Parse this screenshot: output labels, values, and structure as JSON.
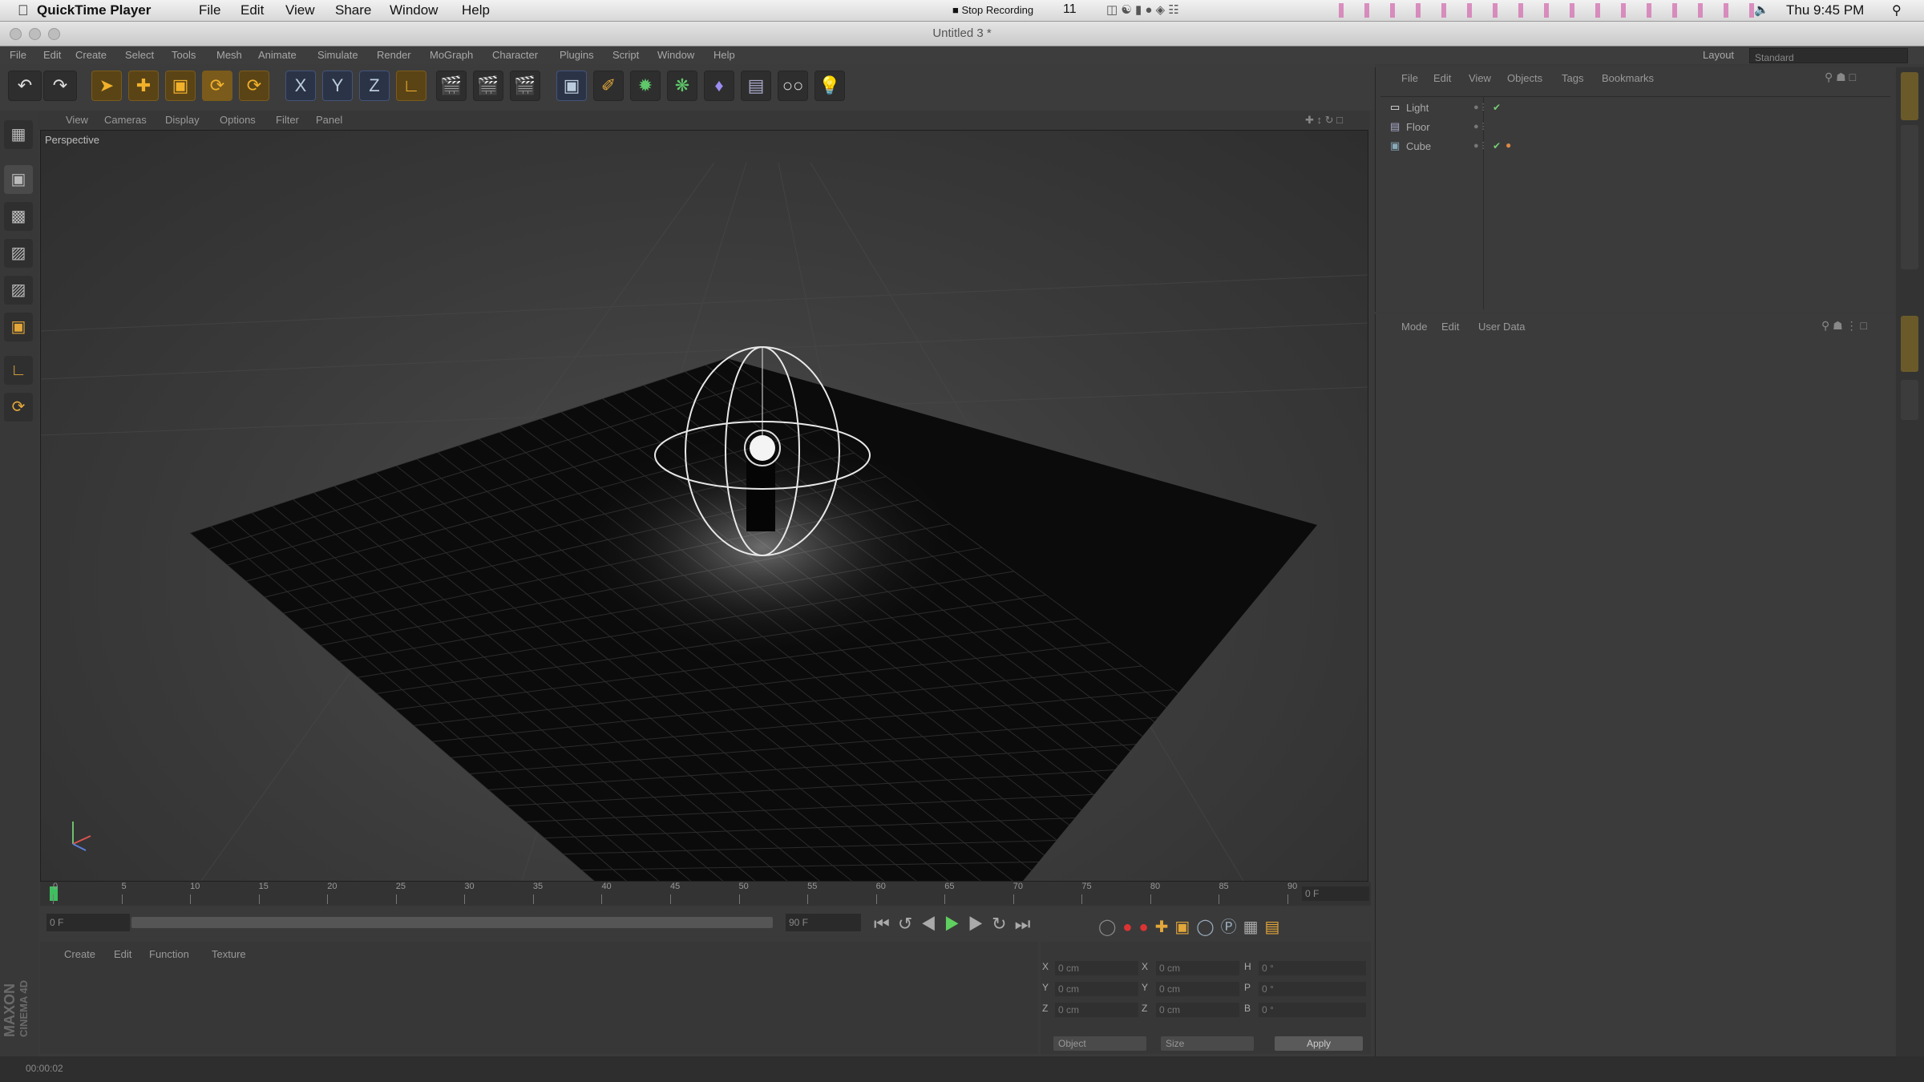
{
  "menubar": {
    "app_name": "QuickTime Player",
    "items": [
      "File",
      "Edit",
      "View",
      "Share",
      "Window",
      "Help"
    ],
    "recording": "Stop Recording",
    "status_count": "11",
    "clock": "Thu 9:45 PM"
  },
  "window": {
    "title": "Untitled 3 *"
  },
  "c4d_menu": [
    "File",
    "Edit",
    "Create",
    "Select",
    "Tools",
    "Mesh",
    "Animate",
    "Simulate",
    "Render",
    "MoGraph",
    "Character",
    "Plugins",
    "Script",
    "Window",
    "Help"
  ],
  "layout": {
    "label": "Layout",
    "value": "Standard"
  },
  "toolbar": {
    "x": "X",
    "y": "Y",
    "z": "Z"
  },
  "viewport": {
    "menu": [
      "View",
      "Cameras",
      "Display",
      "Options",
      "Filter",
      "Panel"
    ],
    "label": "Perspective"
  },
  "object_manager": {
    "menu": [
      "File",
      "Edit",
      "View",
      "Objects",
      "Tags",
      "Bookmarks"
    ],
    "objects": [
      {
        "name": "Light"
      },
      {
        "name": "Floor"
      },
      {
        "name": "Cube"
      }
    ]
  },
  "attribute_manager": {
    "menu": [
      "Mode",
      "Edit",
      "User Data"
    ]
  },
  "timeline": {
    "ticks": [
      "0",
      "5",
      "10",
      "15",
      "20",
      "25",
      "30",
      "35",
      "40",
      "45",
      "50",
      "55",
      "60",
      "65",
      "70",
      "75",
      "80",
      "85",
      "90"
    ],
    "current_frame": "0 F",
    "start": "0 F",
    "end": "90 F",
    "range_end": "90 F"
  },
  "material_manager": {
    "menu": [
      "Create",
      "Edit",
      "Function",
      "Texture"
    ],
    "brand_line1": "MAXON",
    "brand_line2": "CINEMA 4D"
  },
  "coordinates": {
    "rows": [
      {
        "axis": "X",
        "pos": "0 cm",
        "axis2": "X",
        "size": "0 cm",
        "axis3": "H",
        "rot": "0 °"
      },
      {
        "axis": "Y",
        "pos": "0 cm",
        "axis2": "Y",
        "size": "0 cm",
        "axis3": "P",
        "rot": "0 °"
      },
      {
        "axis": "Z",
        "pos": "0 cm",
        "axis2": "Z",
        "size": "0 cm",
        "axis3": "B",
        "rot": "0 °"
      }
    ],
    "mode1": "Object",
    "mode2": "Size",
    "apply": "Apply"
  },
  "status": {
    "time": "00:00:02"
  }
}
